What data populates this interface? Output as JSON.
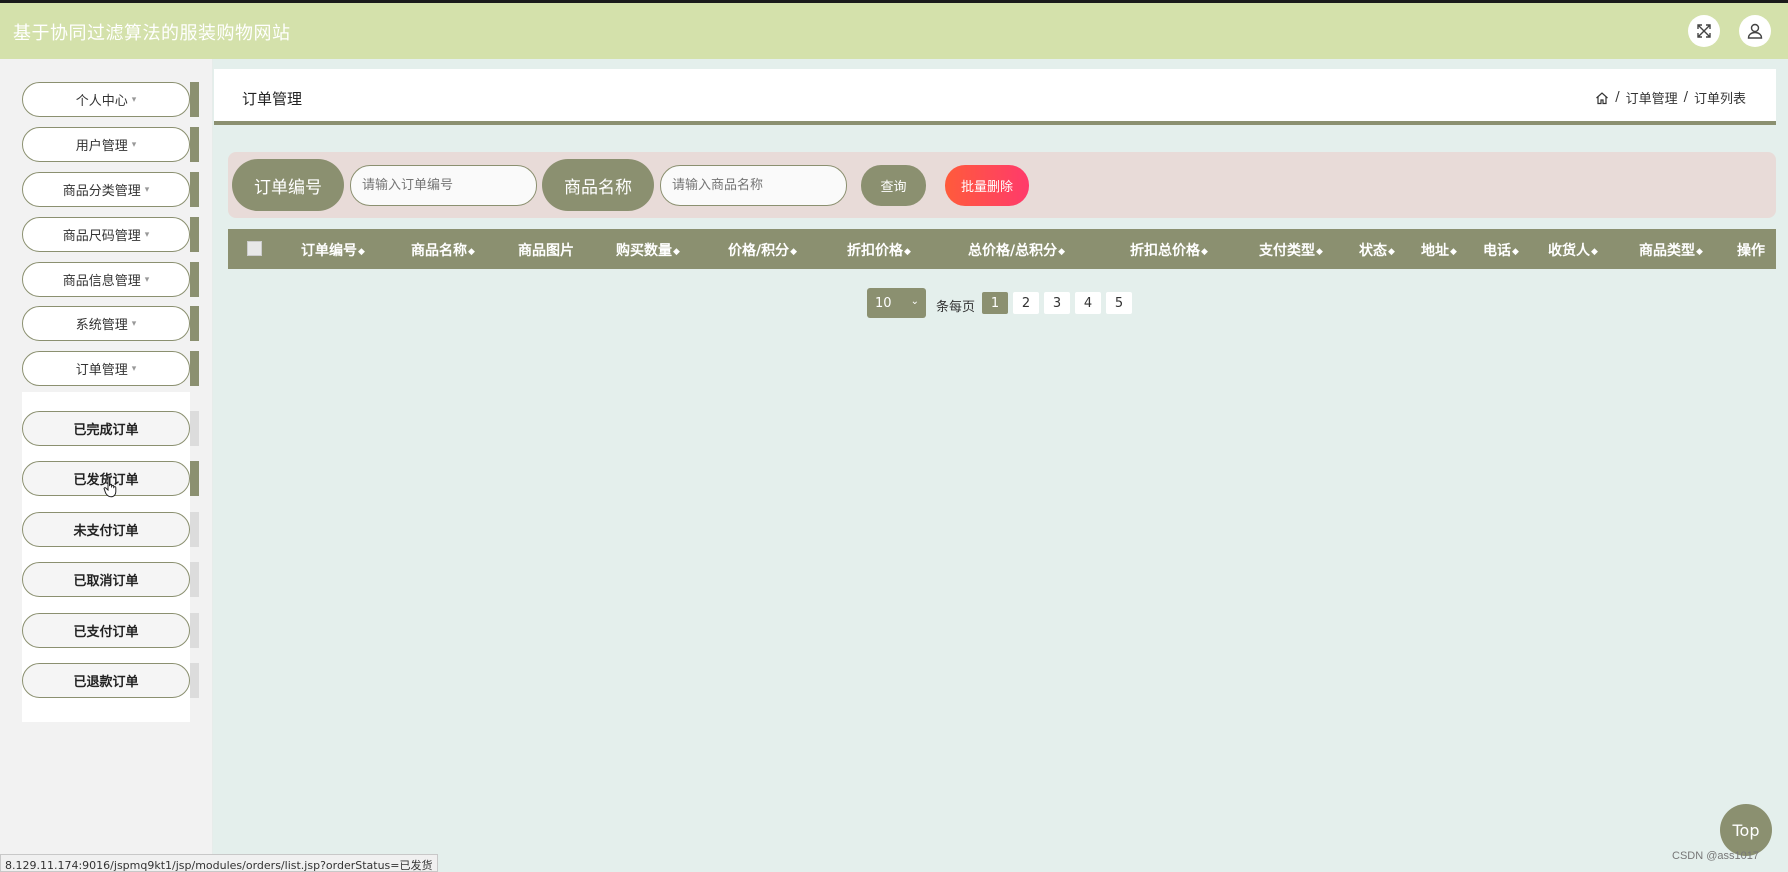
{
  "app": {
    "title": "基于协同过滤算法的服装购物网站"
  },
  "icons": {
    "fullscreen": "fullscreen-icon",
    "user": "user-icon",
    "home": "home-icon",
    "cursor": "hand-cursor-icon"
  },
  "colors": {
    "accent": "#8b9070",
    "topbar": "#d4e1ab",
    "danger": "#ff4a50",
    "background": "#e4efec"
  },
  "sidebar": {
    "menu": [
      {
        "label": "个人中心"
      },
      {
        "label": "用户管理"
      },
      {
        "label": "商品分类管理"
      },
      {
        "label": "商品尺码管理"
      },
      {
        "label": "商品信息管理"
      },
      {
        "label": "系统管理"
      },
      {
        "label": "订单管理"
      }
    ],
    "caret": "▾",
    "submenu": [
      {
        "label": "已完成订单"
      },
      {
        "label": "已发货订单",
        "active": true
      },
      {
        "label": "未支付订单"
      },
      {
        "label": "已取消订单"
      },
      {
        "label": "已支付订单"
      },
      {
        "label": "已退款订单"
      }
    ]
  },
  "header": {
    "title": "订单管理",
    "breadcrumb": {
      "sep": "/",
      "level1": "订单管理",
      "level2": "订单列表"
    }
  },
  "search": {
    "order_no_label": "订单编号",
    "order_no_placeholder": "请输入订单编号",
    "product_name_label": "商品名称",
    "product_name_placeholder": "请输入商品名称",
    "query_button": "查询",
    "batch_delete_button": "批量删除"
  },
  "table": {
    "sort_glyph": "◆",
    "columns": [
      {
        "label": "订单编号",
        "sortable": true
      },
      {
        "label": "商品名称",
        "sortable": true
      },
      {
        "label": "商品图片",
        "sortable": false
      },
      {
        "label": "购买数量",
        "sortable": true
      },
      {
        "label": "价格/积分",
        "sortable": true
      },
      {
        "label": "折扣价格",
        "sortable": true
      },
      {
        "label": "总价格/总积分",
        "sortable": true
      },
      {
        "label": "折扣总价格",
        "sortable": true
      },
      {
        "label": "支付类型",
        "sortable": true
      },
      {
        "label": "状态",
        "sortable": true
      },
      {
        "label": "地址",
        "sortable": true
      },
      {
        "label": "电话",
        "sortable": true
      },
      {
        "label": "收货人",
        "sortable": true
      },
      {
        "label": "商品类型",
        "sortable": true
      },
      {
        "label": "操作",
        "sortable": false
      }
    ],
    "rows": []
  },
  "pagination": {
    "page_size": "10",
    "page_size_arrow": "⌄",
    "per_page_text": "条每页",
    "pages": [
      "1",
      "2",
      "3",
      "4",
      "5"
    ],
    "current_page": 1
  },
  "scroll_top": {
    "label": "Top"
  },
  "status_bar": {
    "url": "8.129.11.174:9016/jspmq9kt1/jsp/modules/orders/list.jsp?orderStatus=已发货"
  },
  "watermark": "CSDN @ass1017"
}
